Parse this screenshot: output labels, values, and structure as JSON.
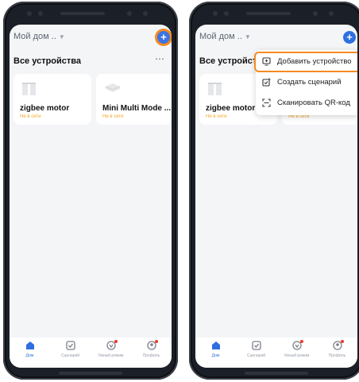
{
  "colors": {
    "accent": "#2f6fe0",
    "highlight": "#f58a1f",
    "offline": "#f5a623",
    "badge": "#f0362a"
  },
  "left": {
    "home_title": "Мой дом ..",
    "section_title": "Все устройства",
    "more_icon": "⋯",
    "devices": [
      {
        "name": "zigbee motor",
        "status": "Не в сети"
      },
      {
        "name": "Mini Multi Mode ...",
        "status": "Не в сети"
      }
    ],
    "tabs": [
      {
        "label": "Дом"
      },
      {
        "label": "Сценарий"
      },
      {
        "label": "Умный режим"
      },
      {
        "label": "Профиль"
      }
    ]
  },
  "right": {
    "home_title": "Мой дом ..",
    "section_title": "Все устройств",
    "devices": [
      {
        "name": "zigbee motor",
        "status": "Не в сети"
      },
      {
        "name": "",
        "status": "Не в сети"
      }
    ],
    "menu": [
      {
        "label": "Добавить устройство",
        "icon": "add-device-icon"
      },
      {
        "label": "Создать сценарий",
        "icon": "add-scene-icon"
      },
      {
        "label": "Сканировать QR-код",
        "icon": "scan-icon"
      }
    ],
    "tabs": [
      {
        "label": "Дом"
      },
      {
        "label": "Сценарий"
      },
      {
        "label": "Умный режим"
      },
      {
        "label": "Профиль"
      }
    ]
  }
}
